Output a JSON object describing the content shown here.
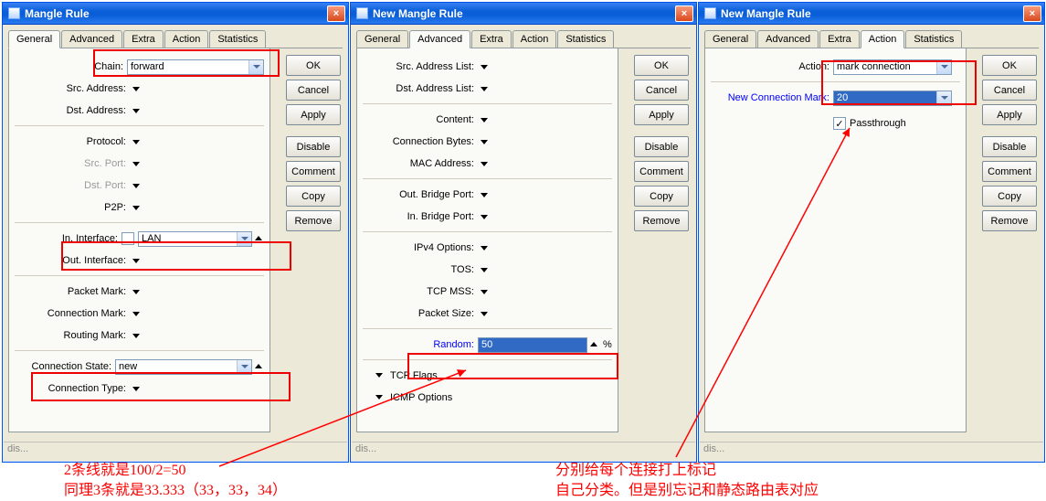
{
  "win1": {
    "title": "Mangle Rule",
    "tabs": [
      "General",
      "Advanced",
      "Extra",
      "Action",
      "Statistics"
    ],
    "activeTab": 0,
    "labels": {
      "chain": "Chain:",
      "srcaddr": "Src. Address:",
      "dstaddr": "Dst. Address:",
      "proto": "Protocol:",
      "srcport": "Src. Port:",
      "dstport": "Dst. Port:",
      "p2p": "P2P:",
      "iniface": "In. Interface:",
      "outiface": "Out. Interface:",
      "pktmark": "Packet Mark:",
      "connmark": "Connection Mark:",
      "routemark": "Routing Mark:",
      "connstate": "Connection State:",
      "conntype": "Connection Type:"
    },
    "values": {
      "chain": "forward",
      "iniface": "LAN",
      "connstate": "new"
    },
    "status": "dis..."
  },
  "win2": {
    "title": "New Mangle Rule",
    "tabs": [
      "General",
      "Advanced",
      "Extra",
      "Action",
      "Statistics"
    ],
    "activeTab": 1,
    "labels": {
      "srclist": "Src. Address List:",
      "dstlist": "Dst. Address List:",
      "content": "Content:",
      "connbytes": "Connection Bytes:",
      "mac": "MAC Address:",
      "outbridge": "Out. Bridge Port:",
      "inbridge": "In. Bridge Port:",
      "ipv4": "IPv4 Options:",
      "tos": "TOS:",
      "tcpmss": "TCP MSS:",
      "pktsize": "Packet Size:",
      "random": "Random:",
      "tcpflags": "TCP Flags",
      "icmp": "ICMP Options"
    },
    "values": {
      "random": "50"
    },
    "pct": "%",
    "status": "dis..."
  },
  "win3": {
    "title": "New Mangle Rule",
    "tabs": [
      "General",
      "Advanced",
      "Extra",
      "Action",
      "Statistics"
    ],
    "activeTab": 3,
    "labels": {
      "action": "Action:",
      "newconn": "New Connection Mark:",
      "pass": "Passthrough"
    },
    "values": {
      "action": "mark connection",
      "newconn": "20"
    },
    "status": "dis..."
  },
  "buttons": {
    "ok": "OK",
    "cancel": "Cancel",
    "apply": "Apply",
    "disable": "Disable",
    "comment": "Comment",
    "copy": "Copy",
    "remove": "Remove"
  },
  "notes": {
    "left": "2条线就是100/2=50\n同理3条就是33.333（33，33，34）",
    "right": "分别给每个连接打上标记\n自己分类。但是别忘记和静态路由表对应"
  }
}
